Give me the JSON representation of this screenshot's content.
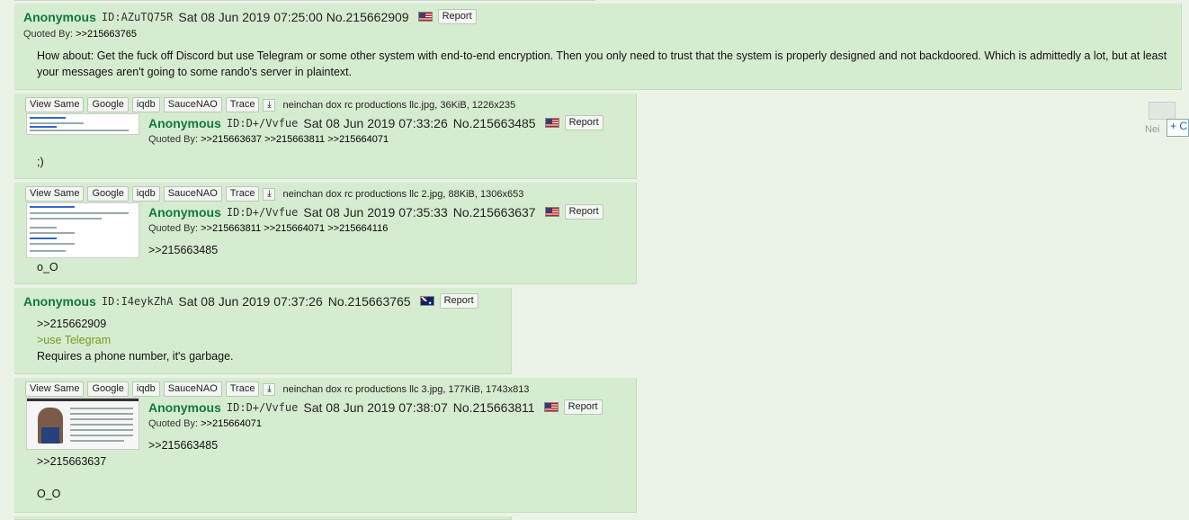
{
  "posts": [
    {
      "name": "Anonymous",
      "id": "ID:AZuTQ75R",
      "datetime": "Sat 08 Jun 2019 07:25:00",
      "no": "No.215662909",
      "report": "Report",
      "quoted_label": "Quoted By:",
      "quoted": ">>215663765",
      "body": "How about: Get the fuck off Discord but use Telegram or some other system with end-to-end encryption. Then you only need to trust that the system is properly designed and not backdoored. Which is admittedly a lot, but at least your messages aren't going to some rando's server in plaintext."
    },
    {
      "file_buttons": [
        "View Same",
        "Google",
        "iqdb",
        "SauceNAO",
        "Trace"
      ],
      "file_info": "neinchan dox rc productions llc.jpg, 36KiB, 1226x235",
      "name": "Anonymous",
      "id": "ID:D+/Vvfue",
      "datetime": "Sat 08 Jun 2019 07:33:26",
      "no": "No.215663485",
      "report": "Report",
      "quoted_label": "Quoted By:",
      "quoted": ">>215663637 >>215663811 >>215664071",
      "body": ";)"
    },
    {
      "file_buttons": [
        "View Same",
        "Google",
        "iqdb",
        "SauceNAO",
        "Trace"
      ],
      "file_info": "neinchan dox rc productions llc 2.jpg, 88KiB, 1306x653",
      "name": "Anonymous",
      "id": "ID:D+/Vvfue",
      "datetime": "Sat 08 Jun 2019 07:35:33",
      "no": "No.215663637",
      "report": "Report",
      "quoted_label": "Quoted By:",
      "quoted": ">>215663811 >>215664071 >>215664116",
      "reply_link": ">>215663485",
      "body": "o_O"
    },
    {
      "name": "Anonymous",
      "id": "ID:I4eykZhA",
      "datetime": "Sat 08 Jun 2019 07:37:26",
      "no": "No.215663765",
      "report": "Report",
      "reply_link": ">>215662909",
      "greentext": ">use Telegram",
      "body": "Requires a phone number, it's garbage."
    },
    {
      "file_buttons": [
        "View Same",
        "Google",
        "iqdb",
        "SauceNAO",
        "Trace"
      ],
      "file_info": "neinchan dox rc productions llc 3.jpg, 177KiB, 1743x813",
      "name": "Anonymous",
      "id": "ID:D+/Vvfue",
      "datetime": "Sat 08 Jun 2019 07:38:07",
      "no": "No.215663811",
      "report": "Report",
      "quoted_label": "Quoted By:",
      "quoted": ">>215664071",
      "reply_link": ">>215663485",
      "reply_link2": ">>215663637",
      "body": "O_O"
    }
  ],
  "floating": {
    "label": "Nei",
    "button": "+ C"
  },
  "colors": {
    "name": "#117743",
    "post_bg": "#d6ecd0",
    "greentext": "#789922"
  },
  "icons": {
    "download": "download-icon",
    "flag_us": "us-flag-icon",
    "flag_au": "au-flag-icon"
  }
}
